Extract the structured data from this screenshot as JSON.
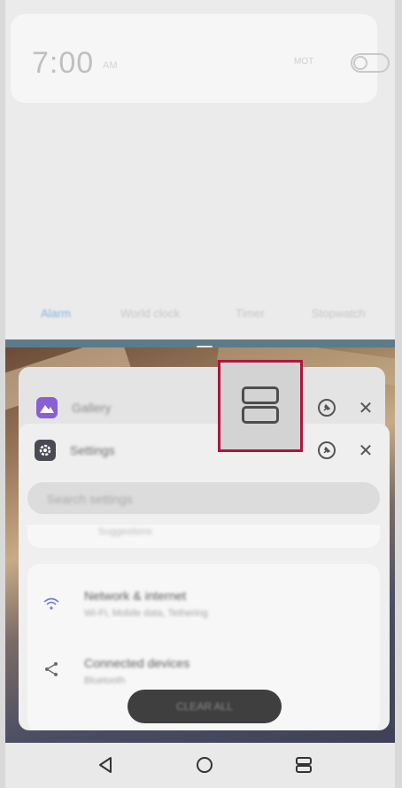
{
  "clock_app": {
    "alarm_time": "7:00",
    "alarm_ampm": "AM",
    "alarm_days": "MOT",
    "tabs": [
      "Alarm",
      "World clock",
      "Timer",
      "Stopwatch"
    ]
  },
  "recents": {
    "back_card_title": "Gallery",
    "front_card_title": "Settings",
    "search_placeholder": "Search settings",
    "suggestion_text": "Suggestions",
    "list": [
      {
        "title": "Network & internet",
        "subtitle": "Wi-Fi, Mobile data, Tethering"
      },
      {
        "title": "Connected devices",
        "subtitle": "Bluetooth"
      }
    ],
    "clear_all_label": "CLEAR ALL"
  },
  "colors": {
    "highlight": "#b0153f",
    "gallery_icon": "#8a5fd4",
    "divider": "#5e7a88"
  },
  "icons": {
    "split_screen": "split-screen-icon",
    "pin": "pin-icon",
    "close": "close-icon",
    "back": "back-triangle-icon",
    "home": "home-circle-icon",
    "recents": "recents-icon"
  }
}
